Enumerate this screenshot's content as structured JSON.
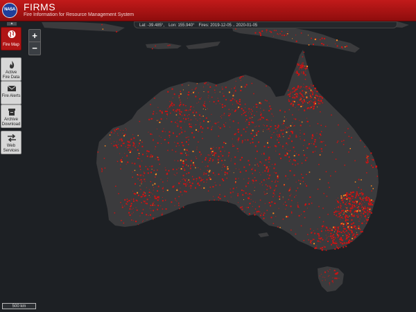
{
  "header": {
    "logo_text": "NASA",
    "title": "FIRMS",
    "subtitle": "Fire Information for Resource Management System"
  },
  "status": {
    "lat": "Lat: -39.485°,",
    "lon": "Lon: 155.940°",
    "fires": "Fires: 2019-12-05 .. 2020-01-05"
  },
  "sidebar": {
    "collapse_glyph": "▲",
    "items": [
      {
        "label": "Fire Map",
        "icon": "globe-icon",
        "active": true
      },
      {
        "label": "Active Fire Data",
        "icon": "flame-icon",
        "active": false
      },
      {
        "label": "Fire Alerts",
        "icon": "envelope-icon",
        "active": false
      },
      {
        "label": "Archive Download",
        "icon": "archive-icon",
        "active": false
      },
      {
        "label": "Web Services",
        "icon": "arrows-icon",
        "active": false
      }
    ]
  },
  "zoom": {
    "in": "+",
    "out": "−"
  },
  "scale_label": "500 km",
  "colors": {
    "header": "#b01515",
    "map_background": "#1d2024",
    "land": "#3b3b3d",
    "fire": "#d11212",
    "fire_hot": "#ff8a1e"
  }
}
